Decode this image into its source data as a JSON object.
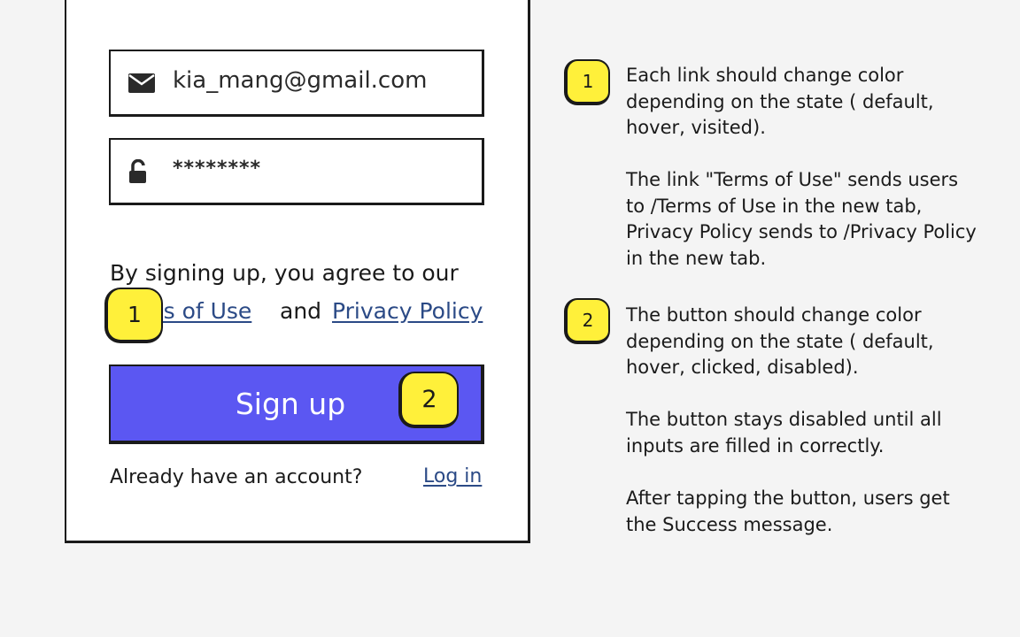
{
  "form": {
    "email_value": "kia_mang@gmail.com",
    "password_value": "********",
    "agree_prefix": "By signing up, you agree to our",
    "terms_link": "Terms of Use",
    "and_word": "and",
    "privacy_link": "Privacy Policy",
    "signup_button": "Sign up",
    "already_text": "Already have an account?",
    "login_link": "Log in"
  },
  "badges": {
    "one": "1",
    "two": "2"
  },
  "notes": {
    "note1_paragraph1": "Each link should change color depending on the state ( default, hover, visited).",
    "note1_paragraph2": "The link \"Terms of Use\" sends users to /Terms of Use in the new tab, Privacy Policy sends to /Privacy Policy in the new tab.",
    "note2_paragraph1": "The button should change color depending on the state ( default, hover, clicked, disabled).",
    "note2_paragraph2": "The button stays disabled until all inputs are filled in correctly.",
    "note2_paragraph3": "After tapping the button, users get the Success message."
  },
  "icons": {
    "email": "envelope-icon",
    "password": "unlocked-padlock-icon"
  },
  "colors": {
    "background": "#f4f4f4",
    "button": "#5b57f2",
    "link": "#2b4a86",
    "badge": "#fff03a"
  }
}
